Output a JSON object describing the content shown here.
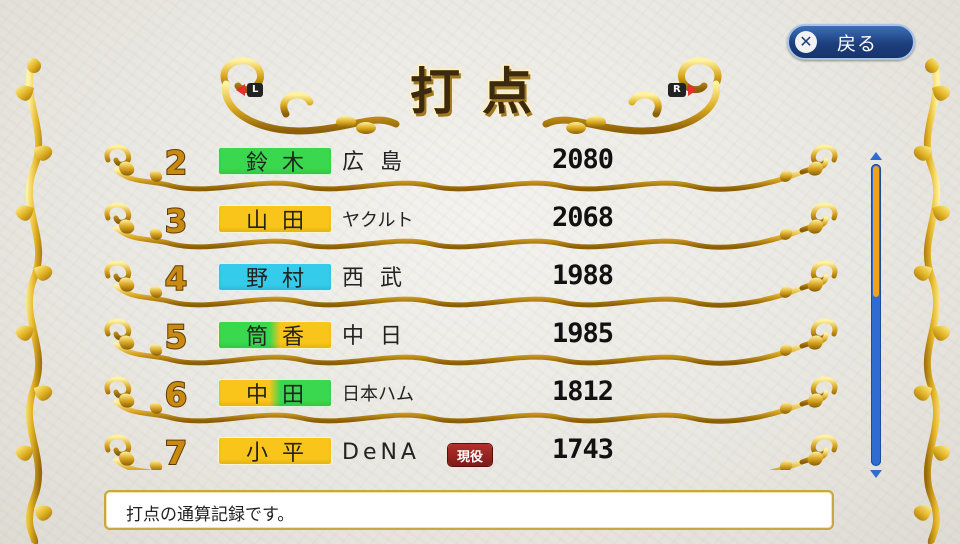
{
  "header": {
    "title": "打点",
    "left_shoulder": "L",
    "right_shoulder": "R"
  },
  "back_button": {
    "label": "戻る",
    "icon": "cross-button-icon"
  },
  "colors": {
    "pacific_plate": "#39d84e",
    "central_plate": "#f9c51a",
    "lions_plate": "#35cbea",
    "active_badge": "#9b2522",
    "accent_gold": "#c98a12",
    "scroll_blue": "#2f6bd0",
    "scroll_thumb": "#f0a21c"
  },
  "rows": [
    {
      "rank": "2",
      "name": "鈴木",
      "team": "広島",
      "value": "2080",
      "plate": [
        "#39d84e",
        "#39d84e"
      ]
    },
    {
      "rank": "3",
      "name": "山田",
      "team": "ヤクルト",
      "value": "2068",
      "plate": [
        "#f9c51a",
        "#f9c51a"
      ]
    },
    {
      "rank": "4",
      "name": "野村",
      "team": "西武",
      "value": "1988",
      "plate": [
        "#35cbea",
        "#35cbea"
      ]
    },
    {
      "rank": "5",
      "name": "筒香",
      "team": "中日",
      "value": "1985",
      "plate": [
        "#39d84e",
        "#f9c51a"
      ]
    },
    {
      "rank": "6",
      "name": "中田",
      "team": "日本ハム",
      "value": "1812",
      "plate": [
        "#f9c51a",
        "#39d84e"
      ]
    },
    {
      "rank": "7",
      "name": "小平",
      "team": "DeNA",
      "value": "1743",
      "plate": [
        "#f9c51a",
        "#f9c51a"
      ],
      "badge": "現役"
    }
  ],
  "scroll": {
    "position_fraction": 0.0,
    "visible_fraction": 0.44
  },
  "message": "打点の通算記録です。"
}
